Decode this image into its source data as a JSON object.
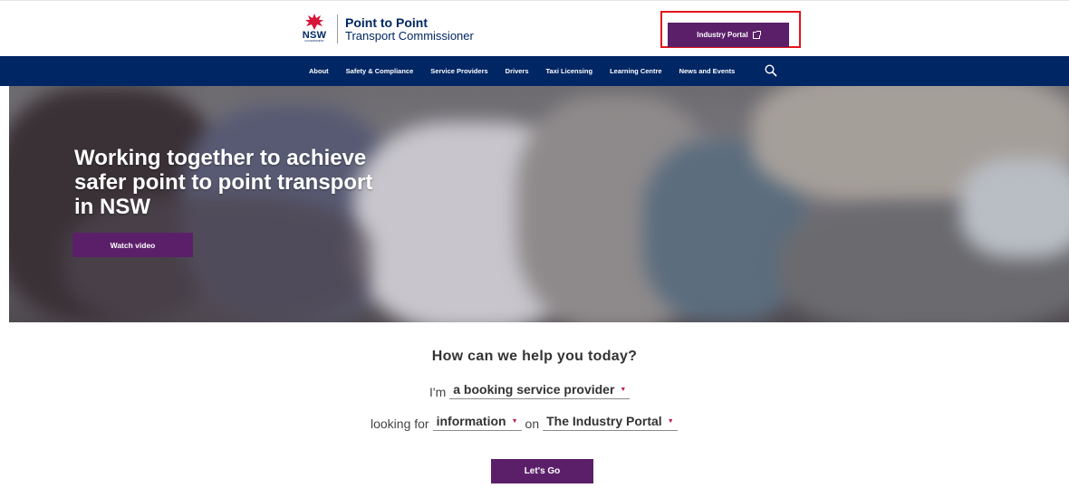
{
  "header": {
    "logo_nsw": "NSW",
    "logo_nsw_sub": "GOVERNMENT",
    "logo_title_line1": "Point to Point",
    "logo_title_line2": "Transport Commissioner",
    "portal_button_label": "Industry Portal",
    "portal_button_icon": "external-link-icon",
    "highlight_color": "#e3161c"
  },
  "nav": {
    "items": [
      {
        "label": "About"
      },
      {
        "label": "Safety & Compliance"
      },
      {
        "label": "Service Providers"
      },
      {
        "label": "Drivers"
      },
      {
        "label": "Taxi Licensing"
      },
      {
        "label": "Learning Centre"
      },
      {
        "label": "News and Events"
      }
    ],
    "search_icon": "search-icon",
    "background": "#002664"
  },
  "hero": {
    "title": "Working together to achieve safer point to point transport in NSW",
    "watch_button_label": "Watch video"
  },
  "help": {
    "title": "How can we help you today?",
    "row1_prefix": "I'm",
    "role_select": "a booking service provider",
    "row2_prefix": "looking for",
    "type_select": "information",
    "row2_middle": "on",
    "topic_select": "The Industry Portal",
    "go_button_label": "Let's Go"
  },
  "colors": {
    "accent_purple": "#5b1f69",
    "navy": "#002664",
    "caret": "#c0174e"
  }
}
